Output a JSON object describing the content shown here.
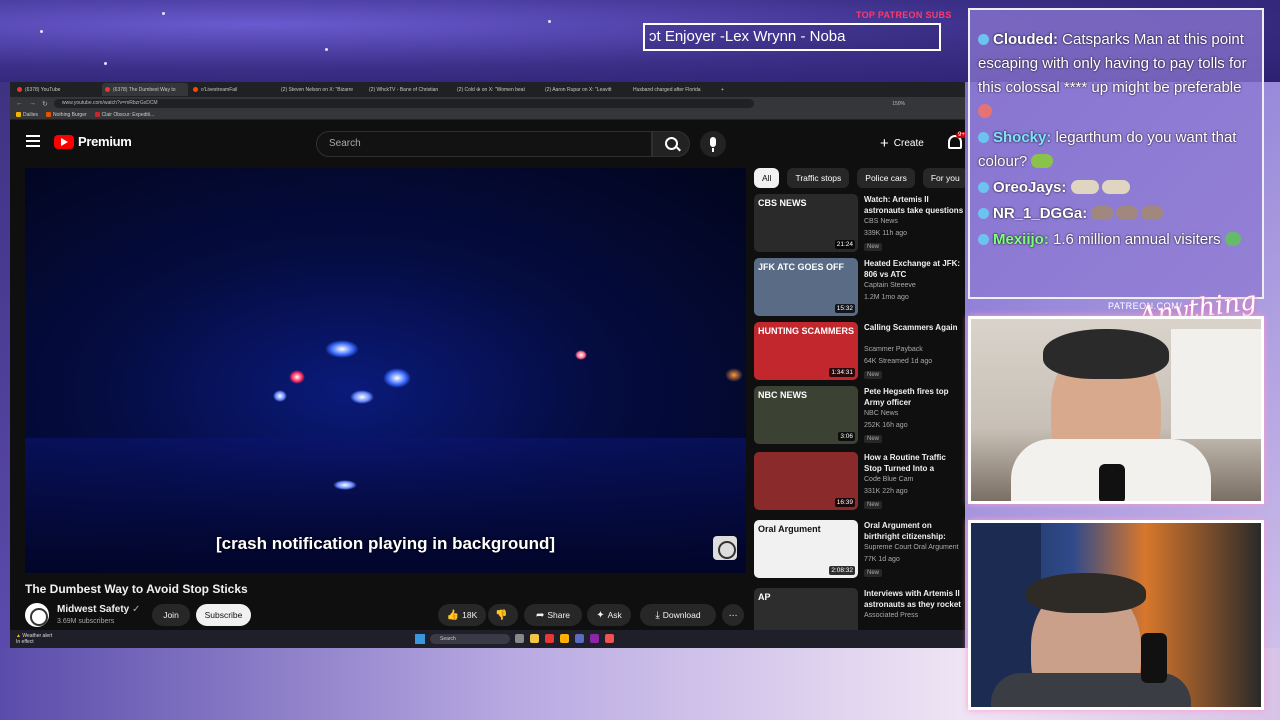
{
  "overlay": {
    "top_label": "TOP PATREON SUBS",
    "ticker_text": "ɔt Enjoyer -Lex Wrynn -  Noba",
    "patreon_url": "PATREON.COM/",
    "brand_script": "Anything"
  },
  "browser": {
    "tabs": [
      {
        "label": "(6378) YouTube",
        "active": false
      },
      {
        "label": "(6378) The Dumbest Way to",
        "active": true
      },
      {
        "label": "o'LivestreamFail",
        "active": false
      },
      {
        "label": "(2) Steven Nelson on X: \"Bizarre",
        "active": false
      },
      {
        "label": "(2) WhckTV - Bane of Christian",
        "active": false
      },
      {
        "label": "(2) Cold ⊕ on X: \"Women beat",
        "active": false
      },
      {
        "label": "(2) Aaron Rupar on X: \"Leavitt",
        "active": false
      },
      {
        "label": "Husband charged after Florida",
        "active": false
      }
    ],
    "url": "www.youtube.com/watch?v=mRbzrGxDCM",
    "zoom": "150%",
    "bookmarks": [
      "Dailies",
      "Nothing Burger",
      "Clair Obscur: Expediti..."
    ]
  },
  "youtube": {
    "logo_text": "Premium",
    "search_placeholder": "Search",
    "create_label": "Create",
    "notif_count": "9+",
    "caption": "[crash notification playing in background]",
    "video_title": "The Dumbest Way to Avoid Stop Sticks",
    "channel_name": "Midwest Safety",
    "channel_subs": "3.69M subscribers",
    "join_label": "Join",
    "subscribe_label": "Subscribe",
    "likes": "18K",
    "share_label": "Share",
    "ask_label": "Ask",
    "download_label": "Download",
    "chips": [
      "All",
      "Traffic stops",
      "Police cars",
      "For you"
    ],
    "recommendations": [
      {
        "title": "Watch: Artemis II astronauts take questions on their way",
        "channel": "CBS News",
        "meta": "339K  11h ago",
        "duration": "21:24",
        "thumb_text": "CBS NEWS",
        "new": "New",
        "thumb_color": "#2a2a2a"
      },
      {
        "title": "Heated Exchange at JFK: 806 vs ATC",
        "channel": "Captain Steeeve",
        "meta": "1.2M  1mo ago",
        "duration": "15:32",
        "thumb_text": "JFK ATC GOES OFF",
        "new": "",
        "thumb_color": "#5a6b85"
      },
      {
        "title": "Calling Scammers Again",
        "channel": "Scammer Payback",
        "meta": "64K  Streamed 1d ago",
        "duration": "1:34:31",
        "thumb_text": "HUNTING SCAMMERS",
        "new": "New",
        "thumb_color": "#c1272d"
      },
      {
        "title": "Pete Hegseth fires top Army officer",
        "channel": "NBC News",
        "meta": "252K  16h ago",
        "duration": "3:06",
        "thumb_text": "NBC NEWS",
        "new": "New",
        "thumb_color": "#3b4233"
      },
      {
        "title": "How a Routine Traffic Stop Turned Into a Complete D...",
        "channel": "Code Blue Cam",
        "meta": "331K  22h ago",
        "duration": "16:39",
        "thumb_text": "",
        "new": "New",
        "thumb_color": "#8a2a2a"
      },
      {
        "title": "Oral Argument on birthright citizenship: Trump v. Barbara",
        "channel": "Supreme Court Oral Argument",
        "meta": "77K  1d ago",
        "duration": "2:08:32",
        "thumb_text": "Oral Argument",
        "new": "New",
        "thumb_color": "#f1f1f1"
      },
      {
        "title": "Interviews with Artemis II astronauts as they rocket",
        "channel": "Associated Press",
        "meta": "",
        "duration": "",
        "thumb_text": "AP",
        "new": "",
        "thumb_color": "#2d2d2d"
      }
    ]
  },
  "taskbar": {
    "weather": "Weather alert",
    "weather_sub": "In effect",
    "search_placeholder": "Search"
  },
  "chat": [
    {
      "user": "Clouded:",
      "user_color": "#ffffff",
      "text": "Catsparks Man at this point escaping with only having to pay tolls for this colossal **** up might be preferable"
    },
    {
      "user": "Shocky:",
      "user_color": "#7fe3ff",
      "text": "legarthum do you want that colour?"
    },
    {
      "user": "OreoJays:",
      "user_color": "#ffffff",
      "text": ""
    },
    {
      "user": "NR_1_DGGa:",
      "user_color": "#ffffff",
      "text": ""
    },
    {
      "user": "Mexiijo:",
      "user_color": "#7dff7d",
      "text": "1.6 million annual visiters"
    }
  ]
}
